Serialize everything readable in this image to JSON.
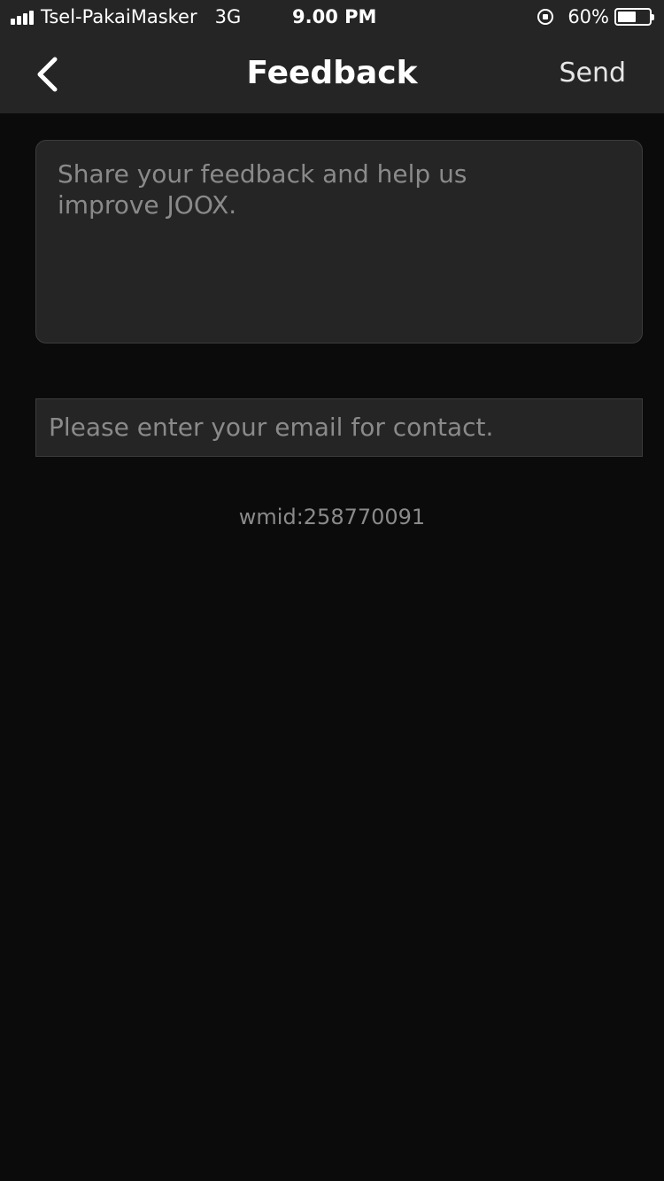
{
  "status_bar": {
    "carrier": "Tsel-PakaiMasker",
    "network": "3G",
    "time": "9.00 PM",
    "battery": "60%",
    "battery_level": 0.6
  },
  "nav": {
    "title": "Feedback",
    "send_label": "Send",
    "back_icon": "chevron-left-icon"
  },
  "form": {
    "feedback_placeholder": "Share your feedback and help us improve JOOX.",
    "email_placeholder": "Please enter your email for contact."
  },
  "footer": {
    "wmid": "wmid:258770091"
  },
  "colors": {
    "background": "#0b0b0c",
    "bar": "#252525",
    "placeholder_text": "#8a8a8a"
  }
}
